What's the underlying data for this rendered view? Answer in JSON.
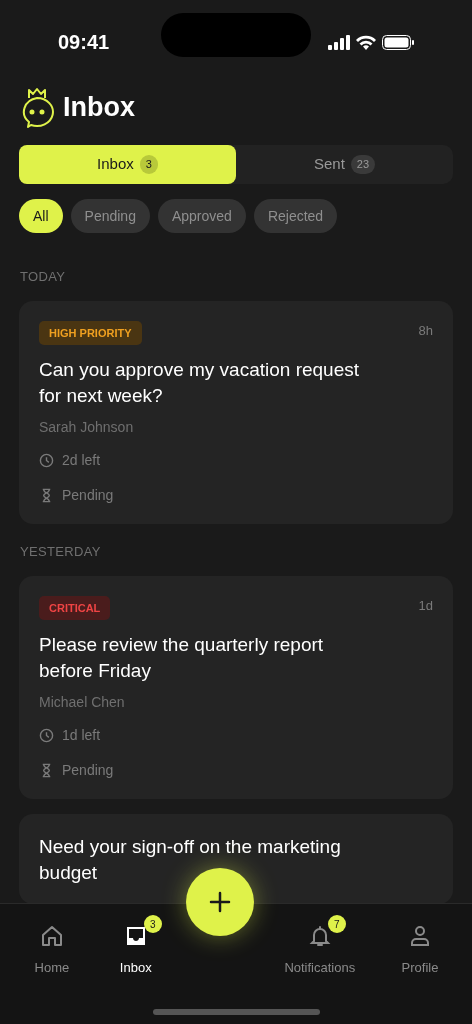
{
  "status_bar": {
    "time": "09:41"
  },
  "header": {
    "title": "Inbox"
  },
  "tabs": [
    {
      "label": "Inbox",
      "count": "3",
      "selected": true
    },
    {
      "label": "Sent",
      "count": "23",
      "selected": false
    }
  ],
  "filters": [
    {
      "label": "All",
      "selected": true
    },
    {
      "label": "Pending",
      "selected": false
    },
    {
      "label": "Approved",
      "selected": false
    },
    {
      "label": "Rejected",
      "selected": false
    }
  ],
  "sections": [
    {
      "heading": "TODAY",
      "messages": [
        {
          "priority": {
            "label": "HIGH PRIORITY",
            "kind": "high"
          },
          "age": "8h",
          "subject": "Can you approve my vacation request for next week?",
          "sender": "Sarah Johnson",
          "due": "2d left",
          "status": "Pending"
        }
      ]
    },
    {
      "heading": "YESTERDAY",
      "messages": [
        {
          "priority": {
            "label": "CRITICAL",
            "kind": "critical"
          },
          "age": "1d",
          "subject": "Please review the quarterly report before Friday",
          "sender": "Michael Chen",
          "due": "1d left",
          "status": "Pending"
        },
        {
          "subject": "Need your sign-off on the marketing budget"
        }
      ]
    }
  ],
  "nav": [
    {
      "label": "Home",
      "kind": "home",
      "selected": false
    },
    {
      "label": "Inbox",
      "kind": "inbox",
      "badge": "3",
      "selected": true
    },
    {
      "kind": "fab"
    },
    {
      "label": "Notifications",
      "kind": "bell",
      "badge": "7",
      "selected": false
    },
    {
      "label": "Profile",
      "kind": "user",
      "selected": false
    }
  ]
}
